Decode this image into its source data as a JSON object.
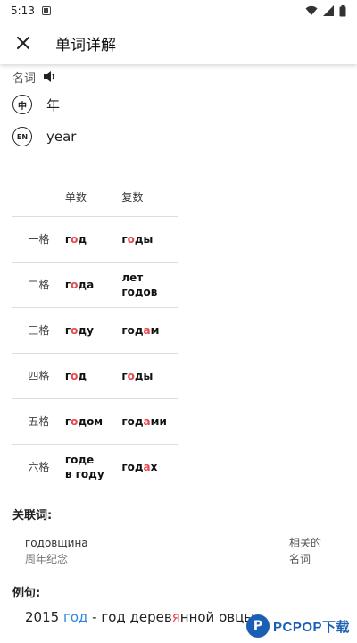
{
  "status": {
    "time": "5:13"
  },
  "header": {
    "title": "单词详解"
  },
  "word": {
    "part_of_speech": "名词",
    "translations": [
      {
        "badge": "中",
        "text": "年"
      },
      {
        "badge": "EN",
        "text": "year"
      }
    ]
  },
  "declension": {
    "columns": [
      "单数",
      "复数"
    ],
    "rows": [
      {
        "case": "一格",
        "singular": [
          [
            "г",
            ""
          ],
          [
            "о",
            "hl"
          ],
          [
            "д",
            ""
          ]
        ],
        "plural": [
          [
            "г",
            ""
          ],
          [
            "о",
            "hl"
          ],
          [
            "ды",
            ""
          ]
        ]
      },
      {
        "case": "二格",
        "singular": [
          [
            "г",
            ""
          ],
          [
            "о",
            "hl"
          ],
          [
            "да",
            ""
          ]
        ],
        "plural_lines": [
          "лет",
          "годов"
        ]
      },
      {
        "case": "三格",
        "singular": [
          [
            "г",
            ""
          ],
          [
            "о",
            "hl"
          ],
          [
            "ду",
            ""
          ]
        ],
        "plural": [
          [
            "год",
            ""
          ],
          [
            "а",
            "hl"
          ],
          [
            "м",
            ""
          ]
        ]
      },
      {
        "case": "四格",
        "singular": [
          [
            "г",
            ""
          ],
          [
            "о",
            "hl"
          ],
          [
            "д",
            ""
          ]
        ],
        "plural": [
          [
            "г",
            ""
          ],
          [
            "о",
            "hl"
          ],
          [
            "ды",
            ""
          ]
        ]
      },
      {
        "case": "五格",
        "singular": [
          [
            "г",
            ""
          ],
          [
            "о",
            "hl"
          ],
          [
            "дом",
            ""
          ]
        ],
        "plural": [
          [
            "год",
            ""
          ],
          [
            "а",
            "hl"
          ],
          [
            "ми",
            ""
          ]
        ]
      },
      {
        "case": "六格",
        "singular_lines": [
          "годе",
          "в году"
        ],
        "plural": [
          [
            "год",
            ""
          ],
          [
            "а",
            "hl"
          ],
          [
            "х",
            ""
          ]
        ]
      }
    ]
  },
  "related": {
    "title": "关联词:",
    "items": [
      {
        "word": "годовщина",
        "meaning": "周年纪念",
        "type_line1": "相关的",
        "type_line2": "名词"
      }
    ]
  },
  "examples": {
    "title": "例句:",
    "first": {
      "prefix": "2015 ",
      "keyword": "год",
      "rest_a": " - год дерев",
      "highlight": "я",
      "rest_b": "нной овцы"
    }
  },
  "watermark": {
    "logo": "P",
    "text": "PCPOP下载"
  }
}
